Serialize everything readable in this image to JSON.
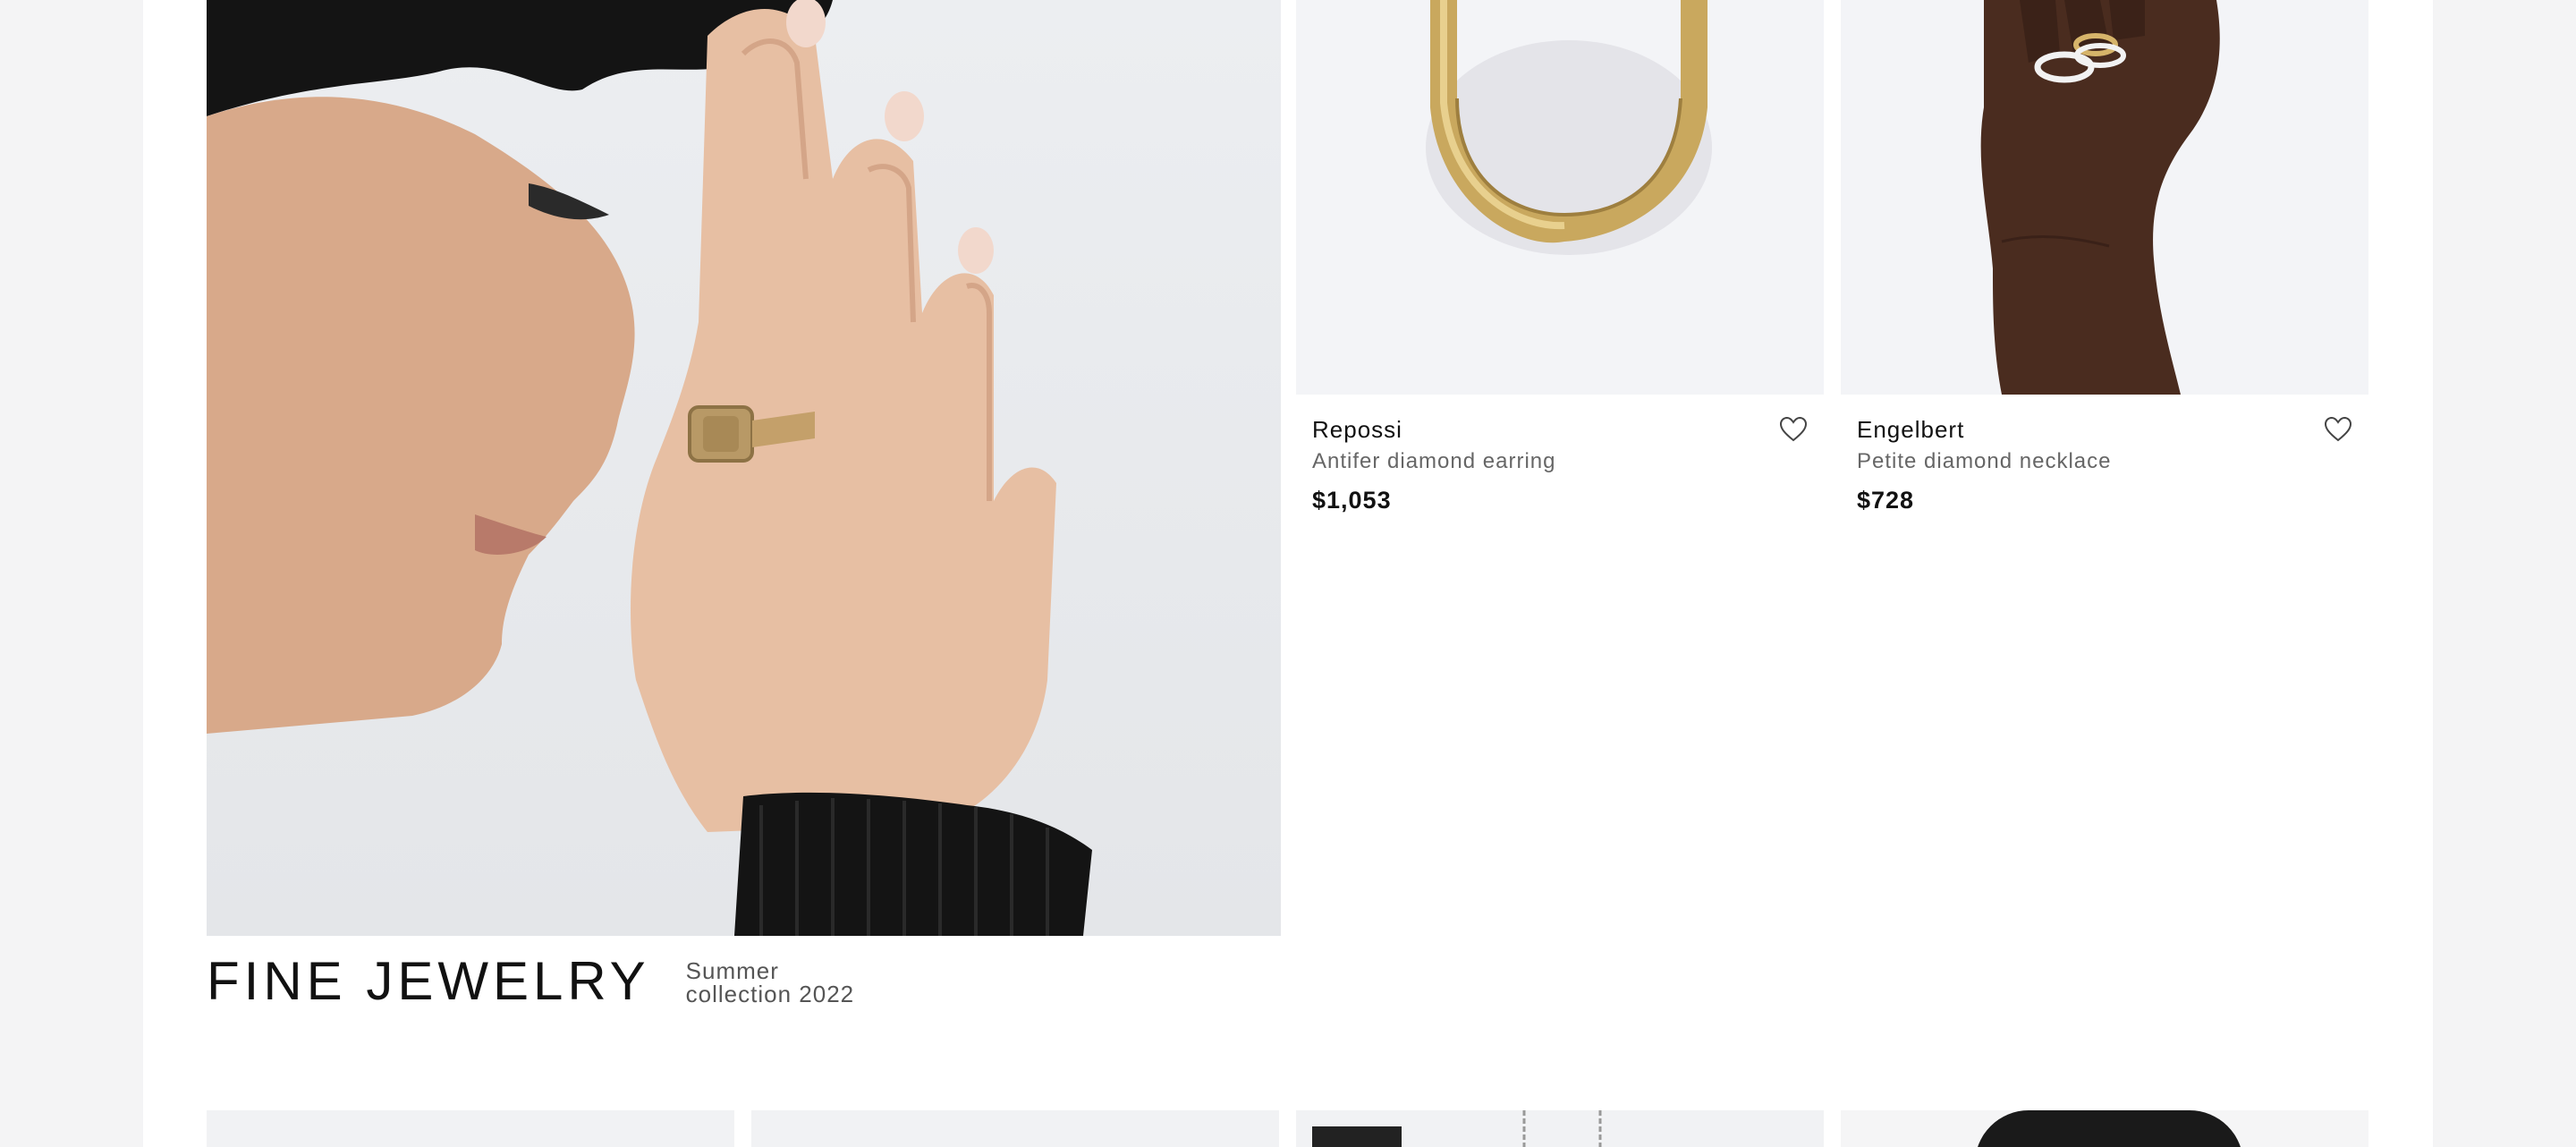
{
  "hero": {
    "title": "FINE JEWELRY",
    "subtitle": "Summer collection 2022"
  },
  "products": [
    {
      "brand": "Repossi",
      "description": "Antifer diamond earring",
      "price": "$1,053",
      "icon": "heart-icon"
    },
    {
      "brand": "Engelbert",
      "description": "Petite diamond necklace",
      "price": "$728",
      "icon": "heart-icon"
    }
  ],
  "colors": {
    "page_bg": "#f4f4f5",
    "content_bg": "#ffffff",
    "text": "#111111",
    "muted": "#666666",
    "tile_bg": "#f3f4f7"
  }
}
